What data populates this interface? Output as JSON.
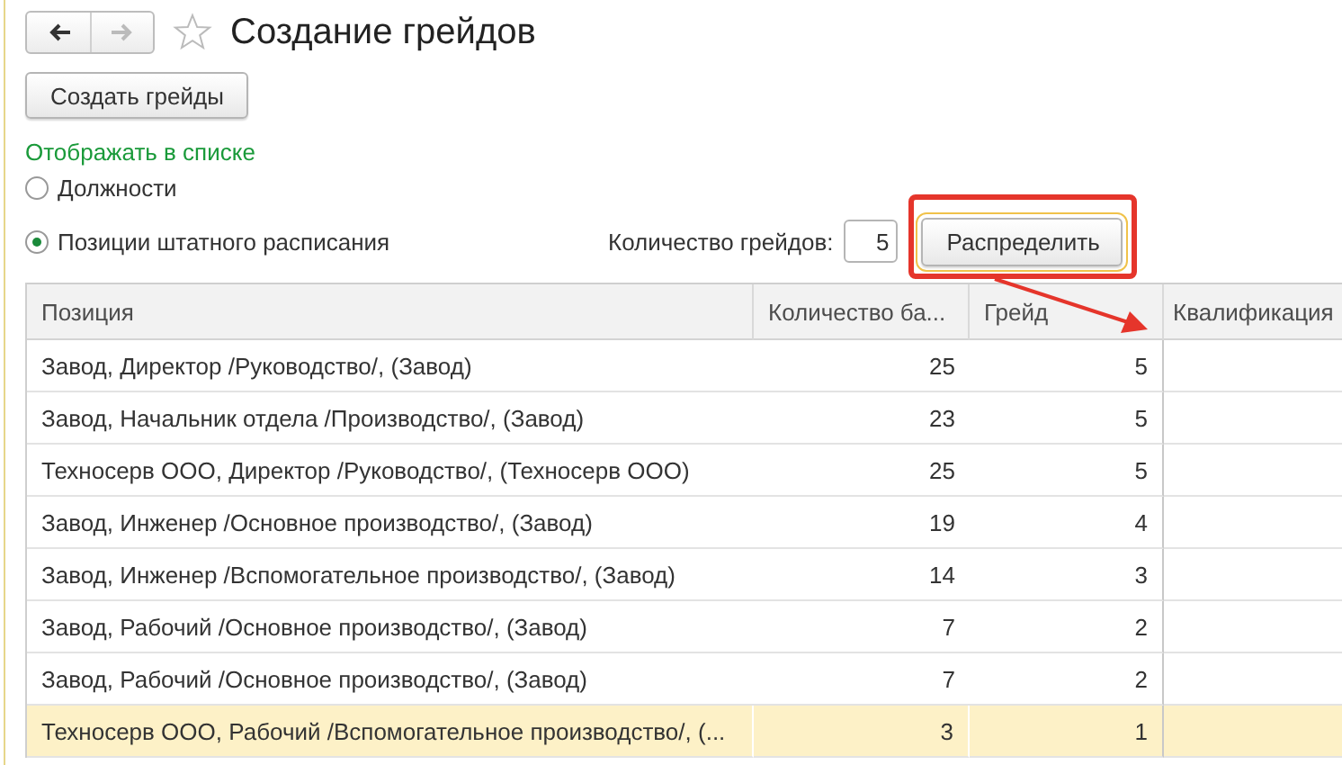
{
  "nav": {
    "back": {
      "disabled": false
    },
    "forward": {
      "disabled": true
    }
  },
  "title": "Создание грейдов",
  "favorite": false,
  "create_button": "Создать грейды",
  "display": {
    "label": "Отображать в списке",
    "options": [
      {
        "label": "Должности",
        "selected": false
      },
      {
        "label": "Позиции штатного расписания",
        "selected": true
      }
    ]
  },
  "grade_count": {
    "label": "Количество грейдов:",
    "value": "5"
  },
  "distribute_button": "Распределить",
  "table": {
    "columns": [
      "Позиция",
      "Количество ба...",
      "Грейд",
      "Квалификация"
    ],
    "rows": [
      {
        "cells": [
          "Завод, Директор /Руководство/, (Завод)",
          "25",
          "5"
        ],
        "selected": false
      },
      {
        "cells": [
          "Завод, Начальник отдела /Производство/, (Завод)",
          "23",
          "5"
        ],
        "selected": false
      },
      {
        "cells": [
          "Техносерв ООО, Директор /Руководство/, (Техносерв ООО)",
          "25",
          "5"
        ],
        "selected": false
      },
      {
        "cells": [
          "Завод, Инженер /Основное производство/, (Завод)",
          "19",
          "4"
        ],
        "selected": false
      },
      {
        "cells": [
          "Завод, Инженер /Вспомогательное производство/, (Завод)",
          "14",
          "3"
        ],
        "selected": false
      },
      {
        "cells": [
          "Завод, Рабочий /Основное производство/, (Завод)",
          "7",
          "2"
        ],
        "selected": false
      },
      {
        "cells": [
          "Завод, Рабочий /Основное производство/, (Завод)",
          "7",
          "2"
        ],
        "selected": false
      },
      {
        "cells": [
          "Техносерв ООО, Рабочий /Вспомогательное производство/, (...",
          "3",
          "1"
        ],
        "selected": true
      }
    ]
  }
}
